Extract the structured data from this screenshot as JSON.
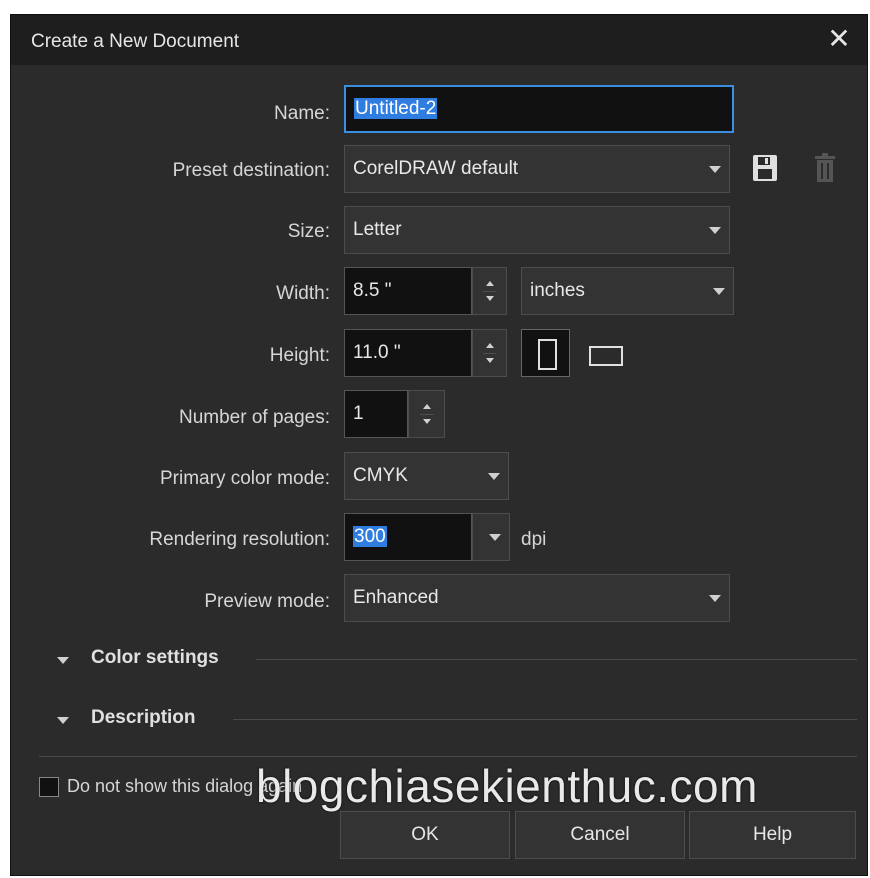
{
  "dialog": {
    "title": "Create a New Document",
    "close_glyph": "✕"
  },
  "form": {
    "name_label": "Name:",
    "name_value": "Untitled-2",
    "preset_label": "Preset destination:",
    "preset_value": "CorelDRAW default",
    "size_label": "Size:",
    "size_value": "Letter",
    "width_label": "Width:",
    "width_value": "8.5 \"",
    "units_value": "inches",
    "height_label": "Height:",
    "height_value": "11.0 \"",
    "pages_label": "Number of pages:",
    "pages_value": "1",
    "color_mode_label": "Primary color mode:",
    "color_mode_value": "CMYK",
    "resolution_label": "Rendering resolution:",
    "resolution_value": "300",
    "resolution_unit": "dpi",
    "preview_label": "Preview mode:",
    "preview_value": "Enhanced"
  },
  "sections": {
    "color_settings": "Color settings",
    "description": "Description"
  },
  "footer": {
    "dont_show_label": "Do not show this dialog again",
    "dont_show_checked": false,
    "ok_label": "OK",
    "cancel_label": "Cancel",
    "help_label": "Help"
  },
  "watermark": "blogchiasekienthuc.com",
  "colors": {
    "background": "#2b2b2b",
    "titlebar": "#1e1e1e",
    "focus": "#3c8fe0",
    "selection": "#2f7de1"
  }
}
